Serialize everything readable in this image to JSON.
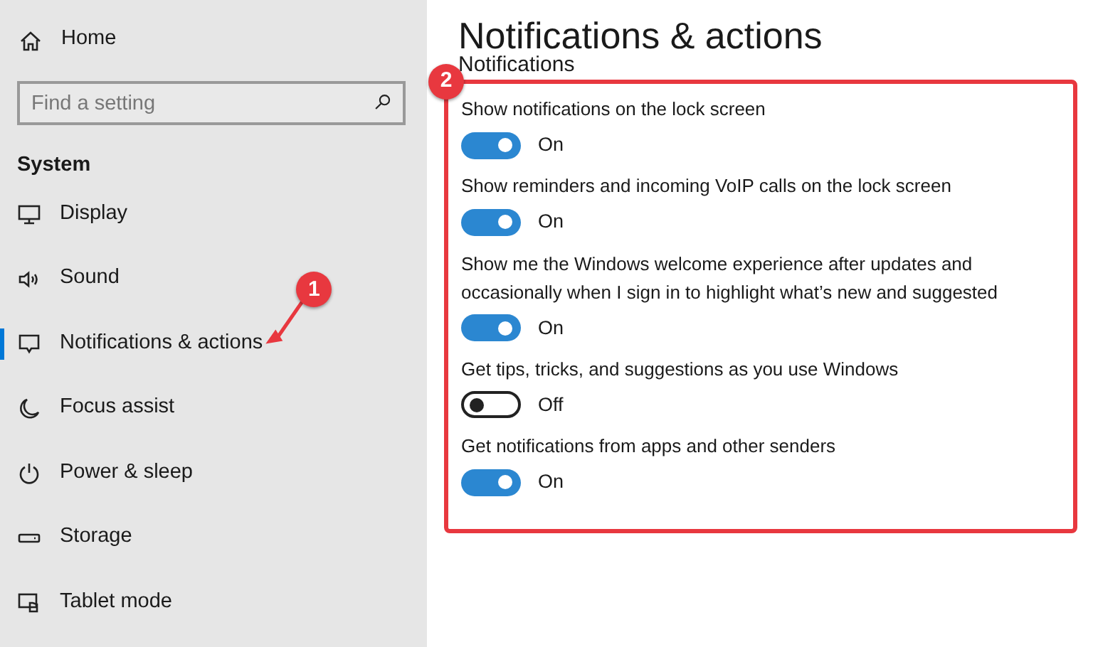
{
  "sidebar": {
    "home": "Home",
    "search": {
      "placeholder": "Find a setting"
    },
    "section": "System",
    "items": [
      {
        "label": "Display",
        "selected": false
      },
      {
        "label": "Sound",
        "selected": false
      },
      {
        "label": "Notifications & actions",
        "selected": true
      },
      {
        "label": "Focus assist",
        "selected": false
      },
      {
        "label": "Power & sleep",
        "selected": false
      },
      {
        "label": "Storage",
        "selected": false
      },
      {
        "label": "Tablet mode",
        "selected": false
      }
    ]
  },
  "page": {
    "title": "Notifications & actions",
    "subtitle": "Notifications",
    "settings": [
      {
        "label": "Show notifications on the lock screen",
        "on": true,
        "state_text": "On"
      },
      {
        "label": "Show reminders and incoming VoIP calls on the lock screen",
        "on": true,
        "state_text": "On"
      },
      {
        "label": "Show me the Windows welcome experience after updates and occasionally when I sign in to highlight what’s new and suggested",
        "on": true,
        "state_text": "On"
      },
      {
        "label": "Get tips, tricks, and suggestions as you use Windows",
        "on": false,
        "state_text": "Off"
      },
      {
        "label": "Get notifications from apps and other senders",
        "on": true,
        "state_text": "On"
      }
    ]
  },
  "annotations": [
    {
      "number": "1"
    },
    {
      "number": "2"
    }
  ]
}
